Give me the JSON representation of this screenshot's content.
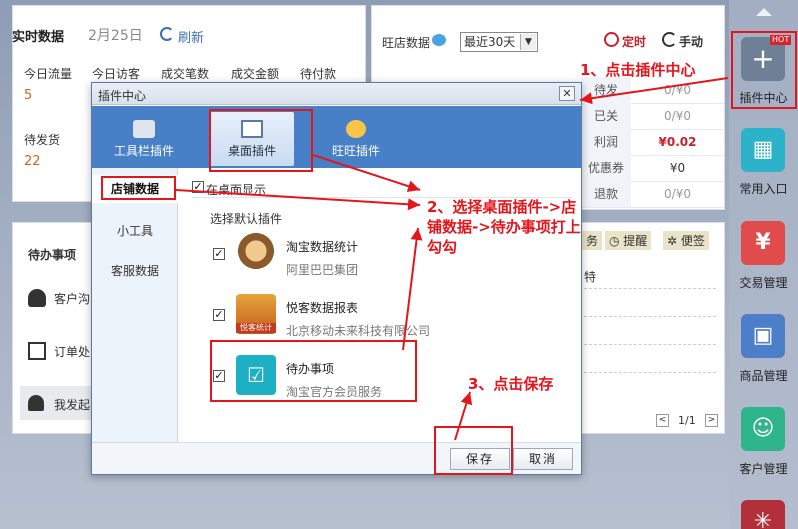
{
  "realtime": {
    "title": "实时数据",
    "date": "2月25日",
    "refresh": "刷新",
    "stats": [
      {
        "label": "今日流量",
        "value": "5"
      },
      {
        "label": "今日访客",
        "value": ""
      },
      {
        "label": "成交笔数",
        "value": ""
      },
      {
        "label": "成交金额",
        "value": ""
      },
      {
        "label": "待付款",
        "value": ""
      }
    ],
    "pending_ship_label": "待发货",
    "pending_ship_value": "22"
  },
  "wangshop": {
    "title": "旺店数据",
    "range": "最近30天",
    "timer": "定时",
    "manual": "手动",
    "rows": [
      {
        "k": "待发",
        "v": "0/¥0"
      },
      {
        "k": "已关",
        "v": "0/¥0"
      },
      {
        "k": "利润",
        "v": "¥0.02"
      },
      {
        "k": "优惠券",
        "v": "¥0"
      },
      {
        "k": "退款",
        "v": "0/¥0"
      }
    ]
  },
  "todo": {
    "title": "待办事项",
    "items": [
      "客户沟",
      "订单处",
      "我发起"
    ]
  },
  "mid_panel": {
    "tabs": [
      "务",
      "提醒",
      "便签"
    ],
    "text": "特",
    "pager": "1/1"
  },
  "sidebar": {
    "hot": "HOT",
    "items": [
      {
        "label": "插件中心",
        "color": "#6f7f96"
      },
      {
        "label": "常用入口",
        "color": "#2db3c9"
      },
      {
        "label": "交易管理",
        "color": "#e04b4b"
      },
      {
        "label": "商品管理",
        "color": "#4c7ec9"
      },
      {
        "label": "客户管理",
        "color": "#2eb58a"
      },
      {
        "label": "",
        "color": "#b2303a"
      }
    ]
  },
  "modal": {
    "title": "插件中心",
    "close": "✕",
    "tabs": [
      {
        "label": "工具栏插件"
      },
      {
        "label": "桌面插件"
      },
      {
        "label": "旺旺插件"
      }
    ],
    "nav": [
      "店铺数据",
      "小工具",
      "客服数据"
    ],
    "show_on_desktop": "在桌面显示",
    "choose_default": "选择默认插件",
    "plugins": [
      {
        "name": "淘宝数据统计",
        "vendor": "阿里巴巴集团"
      },
      {
        "name": "悦客数据报表",
        "vendor": "北京移动未来科技有限公司",
        "icon_text": "悦客统计"
      },
      {
        "name": "待办事项",
        "vendor": "淘宝官方会员服务"
      }
    ],
    "save": "保存",
    "cancel": "取消"
  },
  "annotations": {
    "step1": "1、点击插件中心",
    "step2": "2、选择桌面插件->店铺数据->待办事项打上勾勾",
    "step3": "3、点击保存"
  }
}
